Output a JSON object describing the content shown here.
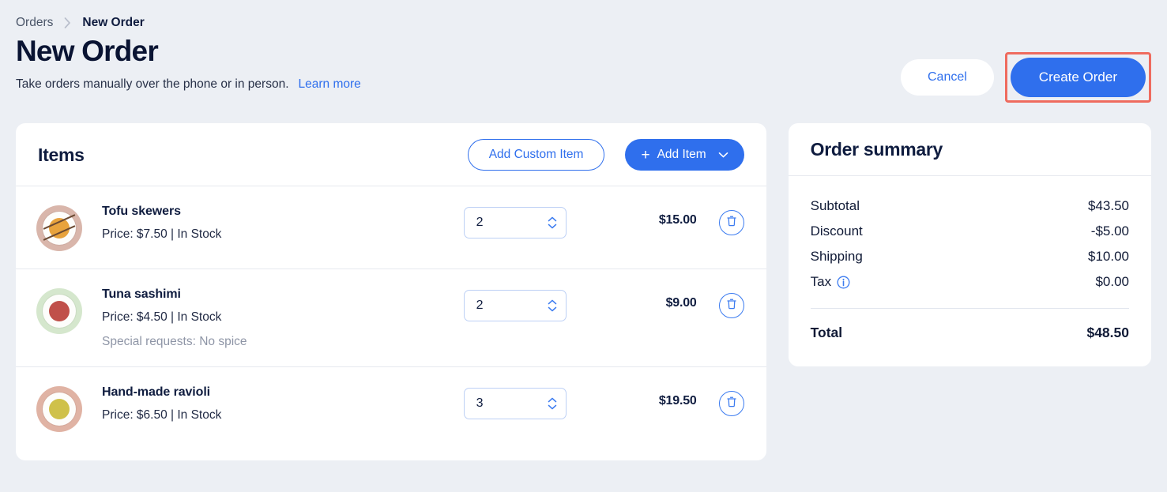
{
  "breadcrumb": {
    "parent": "Orders",
    "current": "New Order",
    "separator_icon": "chevron-right-icon"
  },
  "header": {
    "title": "New Order",
    "subtitle": "Take orders manually over the phone or in person.",
    "learn_more": "Learn more",
    "cancel_label": "Cancel",
    "create_label": "Create Order",
    "highlight_color": "#ef6b5e",
    "accent_color": "#2f6fed"
  },
  "items": {
    "title": "Items",
    "add_custom_label": "Add Custom Item",
    "add_item_label": "Add Item",
    "add_item_plus_icon": "plus-icon",
    "add_item_chevron_icon": "chevron-down-icon",
    "rows": [
      {
        "name": "Tofu skewers",
        "meta": "Price: $7.50  |  In Stock",
        "special": "",
        "qty": "2",
        "price": "$15.00",
        "thumb_icon": "tofu-skewers-photo",
        "thumb_bg": "#d9b6ab",
        "food_color": "#e8a33d",
        "delete_icon": "trash-icon",
        "stepper_icon": "chevron-up-down-icon"
      },
      {
        "name": "Tuna sashimi",
        "meta": "Price: $4.50  |  In Stock",
        "special": "Special requests: No spice",
        "qty": "2",
        "price": "$9.00",
        "thumb_icon": "tuna-sashimi-photo",
        "thumb_bg": "#d5e7cd",
        "food_color": "#c0504a",
        "delete_icon": "trash-icon",
        "stepper_icon": "chevron-up-down-icon"
      },
      {
        "name": "Hand-made ravioli",
        "meta": "Price: $6.50  |  In Stock",
        "special": "",
        "qty": "3",
        "price": "$19.50",
        "thumb_icon": "hand-made-ravioli-photo",
        "thumb_bg": "#e0b3a4",
        "food_color": "#cfc14a",
        "delete_icon": "trash-icon",
        "stepper_icon": "chevron-up-down-icon"
      }
    ]
  },
  "summary": {
    "title": "Order summary",
    "lines": [
      {
        "label": "Subtotal",
        "value": "$43.50",
        "info": false
      },
      {
        "label": "Discount",
        "value": "-$5.00",
        "info": false
      },
      {
        "label": "Shipping",
        "value": "$10.00",
        "info": false
      },
      {
        "label": "Tax",
        "value": "$0.00",
        "info": true
      }
    ],
    "tax_info_icon": "info-icon",
    "total_label": "Total",
    "total_value": "$48.50"
  }
}
